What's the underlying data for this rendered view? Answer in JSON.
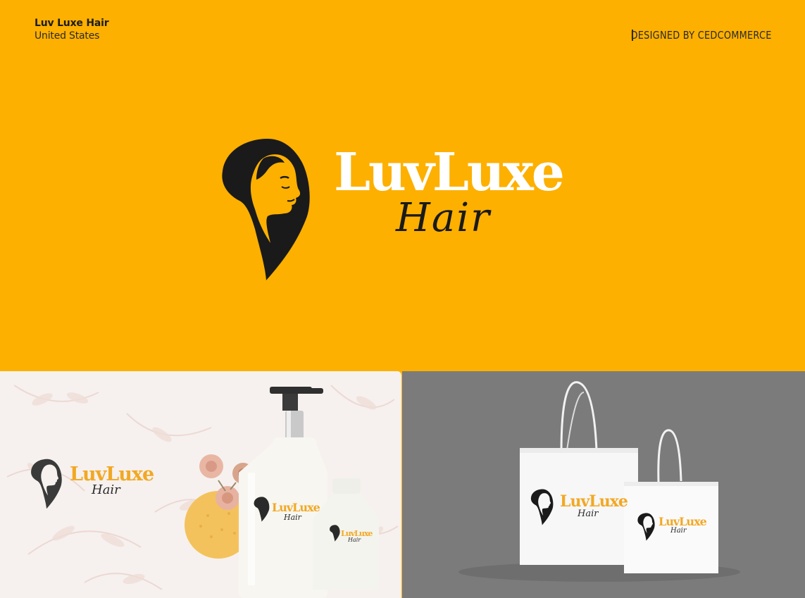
{
  "header": {
    "client_name": "Luv Luxe Hair",
    "client_location": "United States",
    "credit": "DESIGNED BY CEDCOMMERCE"
  },
  "logo": {
    "wordmark": "LuvLuxe",
    "script": "Hair",
    "icon": "woman-profile-icon"
  },
  "colors": {
    "brand_yellow": "#fdb000",
    "ink": "#1a1a1a",
    "white": "#ffffff",
    "gold_text": "#f2a824",
    "mockup_bg_left": "#f6f1ee",
    "mockup_bg_right": "#7b7b7b"
  },
  "mockups": {
    "left": {
      "wordmark": "LuvLuxe",
      "script": "Hair",
      "bottle_wordmark": "LuvLuxe",
      "bottle_script": "Hair",
      "small_bottle_wordmark": "LuvLuxe",
      "small_bottle_script": "Hair"
    },
    "right": {
      "bag_large_wordmark": "LuvLuxe",
      "bag_large_script": "Hair",
      "bag_small_wordmark": "LuvLuxe",
      "bag_small_script": "Hair"
    }
  }
}
